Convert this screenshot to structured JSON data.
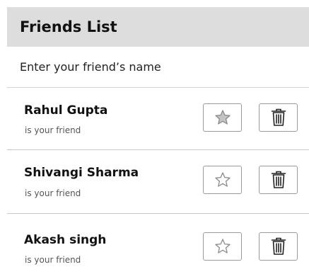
{
  "header": {
    "title": "Friends List"
  },
  "input": {
    "placeholder": "Enter your friend’s name",
    "value": ""
  },
  "friends": [
    {
      "name": "Rahul Gupta",
      "status": "is your friend",
      "starred": true
    },
    {
      "name": "Shivangi Sharma",
      "status": "is your friend",
      "starred": false
    },
    {
      "name": "Akash singh",
      "status": "is your friend",
      "starred": false
    }
  ],
  "icons": {
    "star": "star-icon",
    "delete": "trash-icon"
  },
  "colors": {
    "header_bg": "#dddddd",
    "star_filled": "#c4c4c4",
    "icon_stroke": "#8a8a8a",
    "trash_stroke": "#222222"
  }
}
